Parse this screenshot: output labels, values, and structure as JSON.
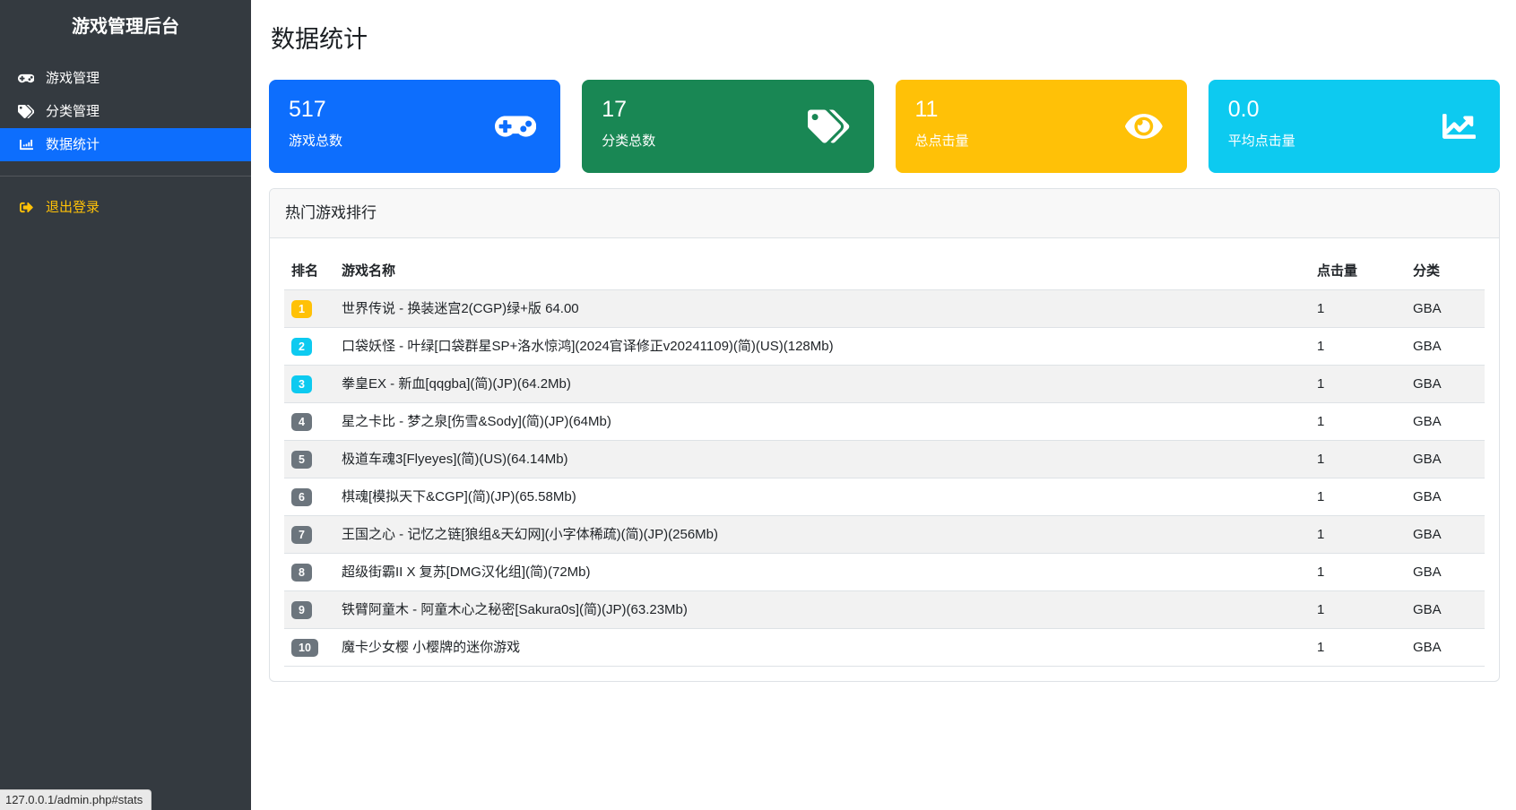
{
  "app": {
    "title": "游戏管理后台"
  },
  "sidebar": {
    "items": [
      {
        "label": "游戏管理",
        "icon": "gamepad-icon"
      },
      {
        "label": "分类管理",
        "icon": "tags-icon"
      },
      {
        "label": "数据统计",
        "icon": "chart-bar-icon",
        "active": true
      }
    ],
    "logout": {
      "label": "退出登录",
      "icon": "sign-out-icon",
      "color": "#ffc107"
    },
    "active_color": "#0d6efd"
  },
  "page": {
    "title": "数据统计"
  },
  "stats": [
    {
      "value": "517",
      "label": "游戏总数",
      "color": "#0d6efd",
      "icon": "gamepad-icon"
    },
    {
      "value": "17",
      "label": "分类总数",
      "color": "#198754",
      "icon": "tags-icon"
    },
    {
      "value": "11",
      "label": "总点击量",
      "color": "#ffc107",
      "icon": "eye-icon"
    },
    {
      "value": "0.0",
      "label": "平均点击量",
      "color": "#0dcaf0",
      "icon": "chart-line-icon"
    }
  ],
  "ranking": {
    "title": "热门游戏排行",
    "columns": [
      "排名",
      "游戏名称",
      "点击量",
      "分类"
    ],
    "rows": [
      {
        "rank": "1",
        "rank_color": "#ffc107",
        "name": "世界传说 - 换装迷宫2(CGP)绿+版 64.00",
        "clicks": "1",
        "category": "GBA"
      },
      {
        "rank": "2",
        "rank_color": "#0dcaf0",
        "name": "口袋妖怪 - 叶绿[口袋群星SP+洛水惊鸿](2024官译修正v20241109)(简)(US)(128Mb)",
        "clicks": "1",
        "category": "GBA"
      },
      {
        "rank": "3",
        "rank_color": "#0dcaf0",
        "name": "拳皇EX - 新血[qqgba](简)(JP)(64.2Mb)",
        "clicks": "1",
        "category": "GBA"
      },
      {
        "rank": "4",
        "rank_color": "#6c757d",
        "name": "星之卡比 - 梦之泉[伤雪&Sody](简)(JP)(64Mb)",
        "clicks": "1",
        "category": "GBA"
      },
      {
        "rank": "5",
        "rank_color": "#6c757d",
        "name": "极道车魂3[Flyeyes](简)(US)(64.14Mb)",
        "clicks": "1",
        "category": "GBA"
      },
      {
        "rank": "6",
        "rank_color": "#6c757d",
        "name": "棋魂[模拟天下&CGP](简)(JP)(65.58Mb)",
        "clicks": "1",
        "category": "GBA"
      },
      {
        "rank": "7",
        "rank_color": "#6c757d",
        "name": "王国之心 - 记忆之链[狼组&天幻网](小字体稀疏)(简)(JP)(256Mb)",
        "clicks": "1",
        "category": "GBA"
      },
      {
        "rank": "8",
        "rank_color": "#6c757d",
        "name": "超级街霸II X 复苏[DMG汉化组](简)(72Mb)",
        "clicks": "1",
        "category": "GBA"
      },
      {
        "rank": "9",
        "rank_color": "#6c757d",
        "name": "铁臂阿童木 - 阿童木心之秘密[Sakura0s](简)(JP)(63.23Mb)",
        "clicks": "1",
        "category": "GBA"
      },
      {
        "rank": "10",
        "rank_color": "#6c757d",
        "name": "魔卡少女樱 小樱牌的迷你游戏",
        "clicks": "1",
        "category": "GBA"
      }
    ]
  },
  "statusbar": {
    "text": "127.0.0.1/admin.php#stats"
  }
}
